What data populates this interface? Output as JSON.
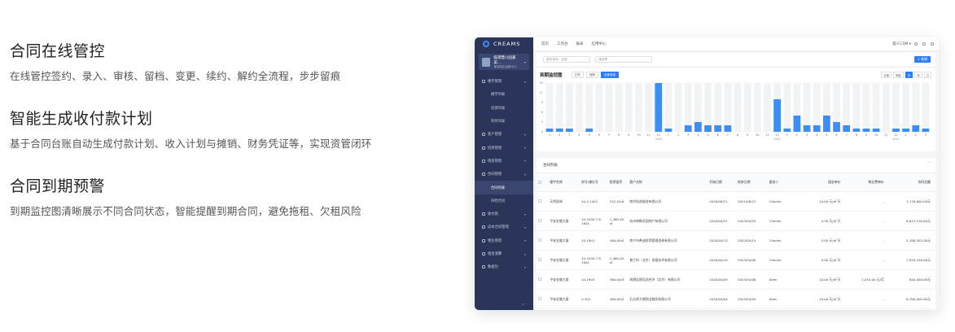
{
  "features": [
    {
      "title": "合同在线管控",
      "desc": "在线管控签约、录入、审核、留档、变更、续约、解约全流程，步步留痕"
    },
    {
      "title": "智能生成收付款计划",
      "desc": "基于合同台账自动生成付款计划、收入计划与摊销、财务凭证等，实现资管闭环"
    },
    {
      "title": "合同到期预警",
      "desc": "到期监控图清晰展示不同合同状态，智能提醒到期合同，避免拖租、欠租风险"
    }
  ],
  "app": {
    "brand": "CREAMS",
    "project": {
      "name": "临港慧川园兼美...",
      "sub": "某某园区运营中心"
    },
    "menu": [
      {
        "label": "楼宇管理",
        "type": "group"
      },
      {
        "label": "楼宇列表",
        "type": "sub"
      },
      {
        "label": "房源列表",
        "type": "sub"
      },
      {
        "label": "项目列表",
        "type": "sub"
      },
      {
        "label": "客户管理",
        "type": "group"
      },
      {
        "label": "招商管理",
        "type": "group"
      },
      {
        "label": "租客管理",
        "type": "group"
      },
      {
        "label": "合同管理",
        "type": "group"
      },
      {
        "label": "合同列表",
        "type": "sub-active"
      },
      {
        "label": "归档合同",
        "type": "sub"
      },
      {
        "label": "收付款",
        "type": "group"
      },
      {
        "label": "成本合同管理",
        "type": "group"
      },
      {
        "label": "物业管理",
        "type": "group"
      },
      {
        "label": "租金测算",
        "type": "group"
      },
      {
        "label": "数据包",
        "type": "group"
      }
    ],
    "sidebar_footer": "≡",
    "topnav": [
      "首页",
      "工作台",
      "报表",
      "应用中心"
    ],
    "user": "超人CSM ▾",
    "filter": {
      "select1": "楼宇查询 · 全部",
      "select2": "请选择",
      "new_button": "+ 新增"
    },
    "chart_title": "到期监控图",
    "chart_tabs": [
      {
        "label": "正常",
        "on": false
      },
      {
        "label": "到期",
        "on": false
      },
      {
        "label": "全部状态",
        "on": true
      }
    ],
    "chart_buttons": [
      {
        "label": "日期",
        "on": false
      },
      {
        "label": "季度",
        "on": false
      },
      {
        "label": "月",
        "on": true
      },
      {
        "label": "年",
        "on": false
      },
      {
        "label": "日",
        "on": false
      }
    ],
    "list_title": "合同列表",
    "list_more": "···",
    "columns": [
      "楼宇名称",
      "房号/铺位号",
      "租赁面积",
      "客户名称",
      "开始日期",
      "结束日期",
      "跟进人",
      "租金单价",
      "物业费单价",
      "合同总额"
    ],
    "rows": [
      [
        "天然園林",
        "10-2-1401",
        "322.42㎡",
        "南京凯途服务有限公司",
        "2020/06/21",
        "2021/06/21",
        "Charles",
        "10.00 元/㎡·天",
        "-",
        "1,176,600.00元"
      ],
      [
        "平安金融大厦",
        "10-1030.7 8-1901",
        "1,460.00㎡",
        "杭州南枫花园地产有限公司",
        "2020/04/21",
        "2023/04/25",
        "Charles",
        "4.30 元/㎡·天",
        "-",
        "6,613,216.00元"
      ],
      [
        "平安金融大厦",
        "10-1901",
        "360.00㎡",
        "南宁市希迪投资管理咨询有限公司",
        "2020/04/13",
        "2022/04/14",
        "Charles",
        "5.00 元/㎡·天",
        "-",
        "2,188,302.00元"
      ],
      [
        "平安金融大厦",
        "10-1030.7 8-1901",
        "1,460.00㎡",
        "普兰科（北京）发展技术有限公司",
        "2020/04/10",
        "2023/04/09",
        "Charles",
        "5.00 元/㎡·天",
        "-",
        "7,920,328.00元"
      ],
      [
        "平安金融大厦",
        "10-1903",
        "360.00㎡",
        "海港区建设总经济（北京）有限公司",
        "2020/04/09",
        "2023/04/08",
        "Allen",
        "10.00 元/㎡·天",
        "1,034.00 元/月",
        "640,000.00元"
      ],
      [
        "平安金融大厦",
        "2-301",
        "360.00㎡",
        "石太原大楼物业服务有限公司",
        "2020/04/04",
        "2023/04/04",
        "Allen",
        "10.00 元/㎡·天",
        "-",
        "6,780,000.00元"
      ]
    ]
  },
  "chart_data": {
    "type": "bar",
    "title": "到期监控图",
    "ylim": [
      0,
      15
    ],
    "yticks": [
      0,
      3,
      6,
      9,
      12,
      15
    ],
    "categories": [
      "1",
      "2",
      "3",
      "4",
      "5",
      "6",
      "7",
      "8",
      "9",
      "10",
      "11",
      "12",
      "1",
      "2",
      "3",
      "4",
      "5",
      "6",
      "7",
      "8",
      "9",
      "10",
      "11",
      "12",
      "1",
      "2",
      "3",
      "4",
      "5",
      "6",
      "7",
      "8",
      "9",
      "10",
      "11",
      "12",
      "1",
      "2",
      "3"
    ],
    "year_labels": [
      {
        "at": 12,
        "label": "2020"
      },
      {
        "at": 24,
        "label": "2021"
      },
      {
        "at": 36,
        "label": "2022"
      }
    ],
    "series": [
      {
        "values": [
          1,
          1,
          1,
          0,
          1,
          0,
          0,
          0,
          0,
          0,
          0,
          15,
          1,
          0,
          2,
          3,
          2,
          2,
          2,
          0,
          0,
          0,
          0,
          10,
          1,
          5,
          2,
          2,
          5,
          3,
          2,
          1,
          1,
          1,
          0,
          1,
          1,
          2,
          1
        ]
      }
    ],
    "background_full": 15,
    "grid": true
  }
}
